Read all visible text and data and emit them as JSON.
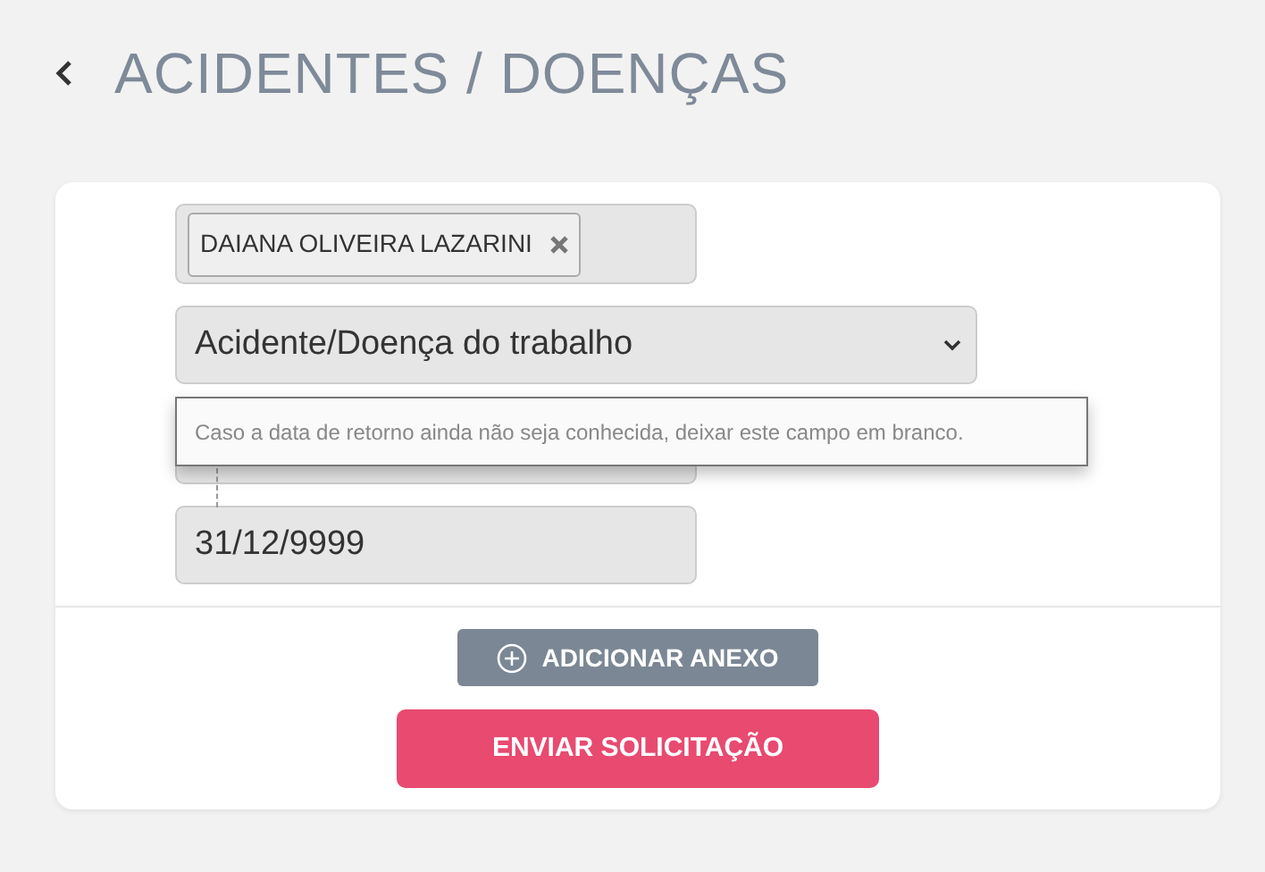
{
  "header": {
    "title": "ACIDENTES / DOENÇAS"
  },
  "employee_field": {
    "tags": [
      {
        "label": "DAIANA OLIVEIRA LAZARINI"
      }
    ]
  },
  "type_select": {
    "value": "Acidente/Doença do trabalho"
  },
  "tooltip": {
    "text": "Caso a data de retorno ainda não seja conhecida, deixar este campo em branco."
  },
  "date_field": {
    "value": "31/12/9999"
  },
  "buttons": [
    {
      "kind": "attach",
      "label": "ADICIONAR ANEXO"
    },
    {
      "kind": "submit",
      "label": "ENVIAR SOLICITAÇÃO"
    }
  ]
}
